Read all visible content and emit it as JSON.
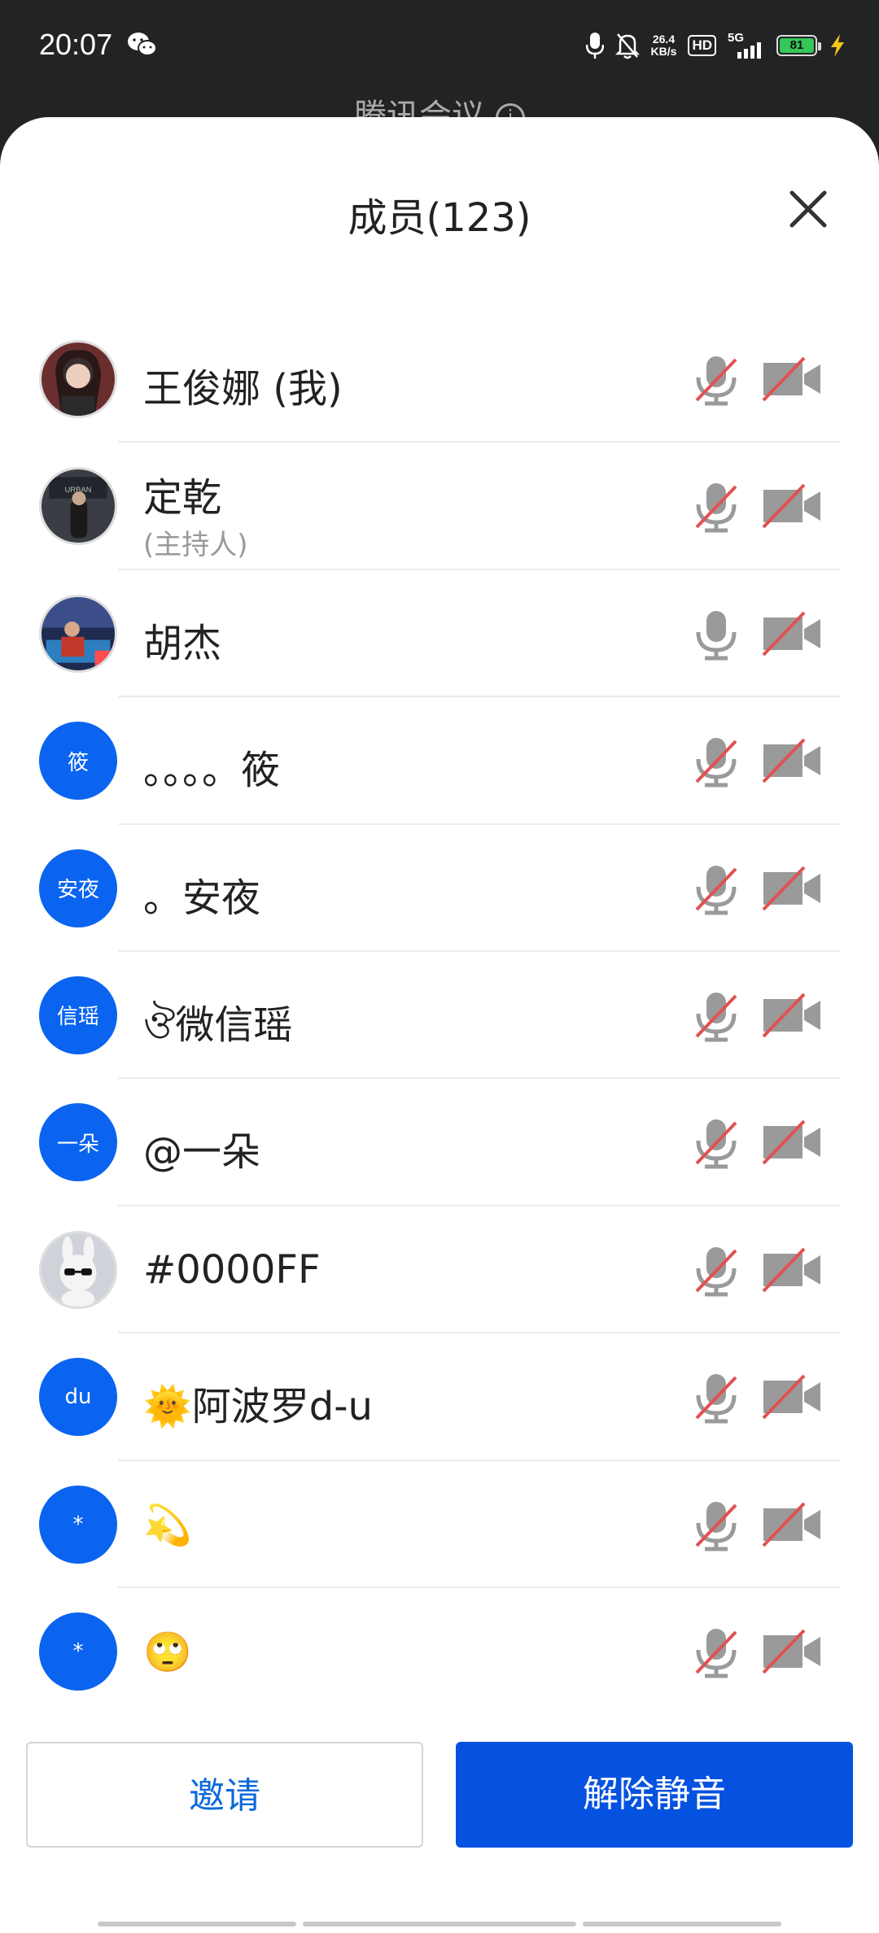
{
  "status_bar": {
    "time": "20:07",
    "net_speed_value": "26.4",
    "net_speed_unit": "KB/s",
    "hd": "HD",
    "signal": "5G",
    "battery": "81",
    "battery_color": "#35c759"
  },
  "background_window": {
    "title": "腾讯会议"
  },
  "sheet": {
    "title": "成员(123)",
    "close_icon": "close-icon"
  },
  "members": [
    {
      "name": "王俊娜 (我)",
      "role": "",
      "avatar_text": "",
      "mic_muted": true
    },
    {
      "name": "定乾",
      "role": "(主持人)",
      "avatar_text": "",
      "mic_muted": true
    },
    {
      "name": "胡杰",
      "role": "",
      "avatar_text": "",
      "mic_muted": false
    },
    {
      "name": "。。。。筱",
      "role": "",
      "avatar_text": "筱",
      "mic_muted": true
    },
    {
      "name": "。安夜",
      "role": "",
      "avatar_text": "安夜",
      "mic_muted": true
    },
    {
      "name": "ঔ微信瑶",
      "role": "",
      "avatar_text": "信瑶",
      "mic_muted": true
    },
    {
      "name": "@一朵",
      "role": "",
      "avatar_text": "一朵",
      "mic_muted": true
    },
    {
      "name": "#0000FF",
      "role": "",
      "avatar_text": "",
      "mic_muted": true
    },
    {
      "name": "🌞阿波罗d-u",
      "role": "",
      "avatar_text": "du",
      "mic_muted": true
    },
    {
      "name": "💫",
      "role": "",
      "avatar_text": "*",
      "mic_muted": true
    },
    {
      "name": "🙄",
      "role": "",
      "avatar_text": "*",
      "mic_muted": true
    }
  ],
  "actions": {
    "invite_label": "邀请",
    "unmute_label": "解除静音"
  },
  "colors": {
    "accent": "#0652e0",
    "avatar_blue": "#0a64f0",
    "invite_text": "#0b6ad8",
    "muted_slash": "#e05252"
  }
}
